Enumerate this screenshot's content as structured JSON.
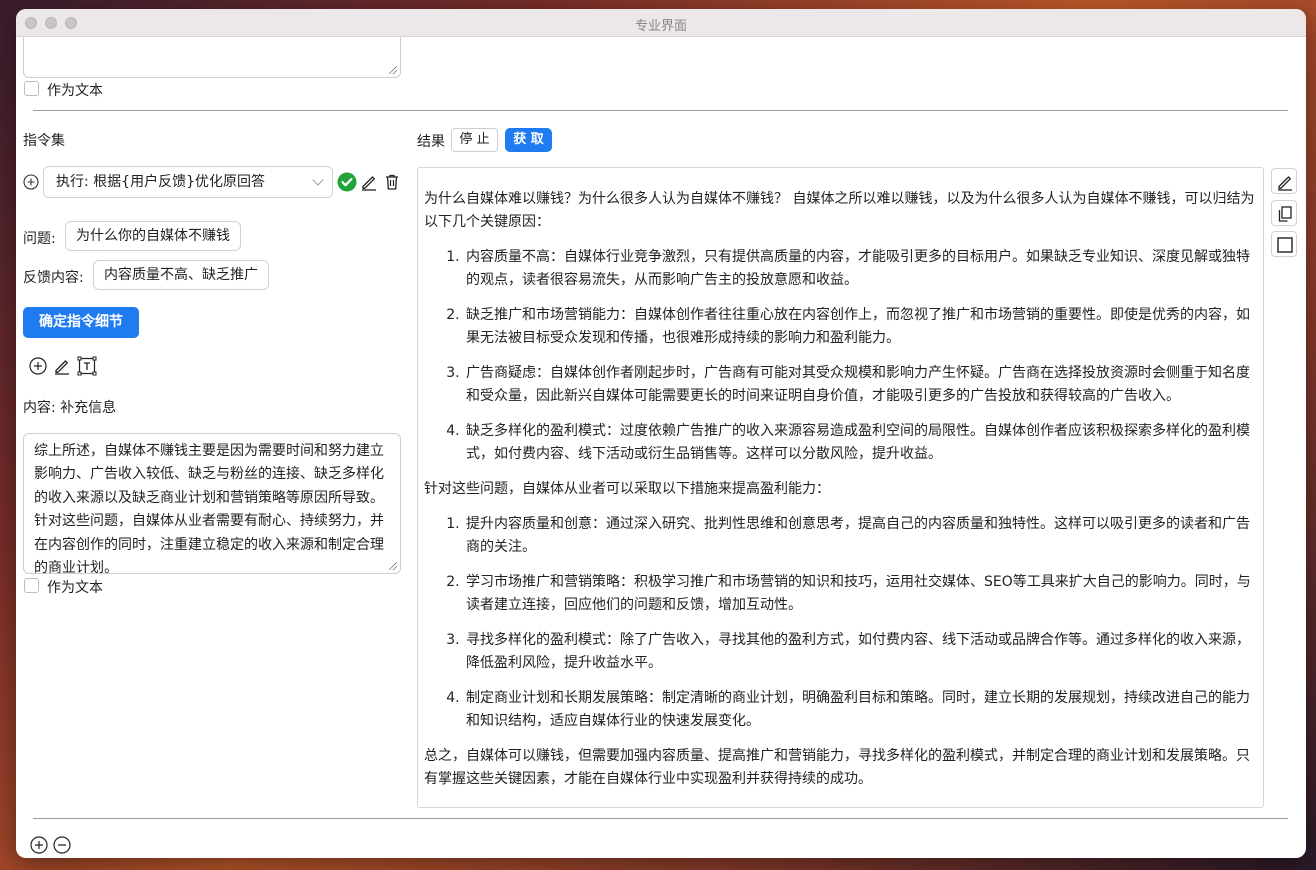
{
  "window": {
    "title": "专业界面"
  },
  "top_section": {
    "as_text_label": "作为文本"
  },
  "instruction_set": {
    "heading": "指令集",
    "command_select": "执行: 根据{用户反馈}优化原回答",
    "question_label": "问题:",
    "question_value": "为什么你的自媒体不赚钱",
    "feedback_label": "反馈内容:",
    "feedback_value": "内容质量不高、缺乏推广",
    "confirm_button": "确定指令细节",
    "content_label": "内容: 补充信息",
    "content_text": "综上所述，自媒体不赚钱主要是因为需要时间和努力建立影响力、广告收入较低、缺乏与粉丝的连接、缺乏多样化的收入来源以及缺乏商业计划和营销策略等原因所导致。针对这些问题，自媒体从业者需要有耐心、持续努力，并在内容创作的同时，注重建立稳定的收入来源和制定合理的商业计划。",
    "as_text_label": "作为文本"
  },
  "result": {
    "label": "结果",
    "stop_button": "停 止",
    "fetch_button": "获 取",
    "intro": "为什么自媒体难以赚钱？为什么很多人认为自媒体不赚钱？ 自媒体之所以难以赚钱，以及为什么很多人认为自媒体不赚钱，可以归结为以下几个关键原因：",
    "reasons": [
      "内容质量不高：自媒体行业竞争激烈，只有提供高质量的内容，才能吸引更多的目标用户。如果缺乏专业知识、深度见解或独特的观点，读者很容易流失，从而影响广告主的投放意愿和收益。",
      "缺乏推广和市场营销能力：自媒体创作者往往重心放在内容创作上，而忽视了推广和市场营销的重要性。即使是优秀的内容，如果无法被目标受众发现和传播，也很难形成持续的影响力和盈利能力。",
      "广告商疑虑：自媒体创作者刚起步时，广告商有可能对其受众规模和影响力产生怀疑。广告商在选择投放资源时会侧重于知名度和受众量，因此新兴自媒体可能需要更长的时间来证明自身价值，才能吸引更多的广告投放和获得较高的广告收入。",
      "缺乏多样化的盈利模式：过度依赖广告推广的收入来源容易造成盈利空间的局限性。自媒体创作者应该积极探索多样化的盈利模式，如付费内容、线下活动或衍生品销售等。这样可以分散风险，提升收益。"
    ],
    "measures_intro": "针对这些问题，自媒体从业者可以采取以下措施来提高盈利能力：",
    "measures": [
      "提升内容质量和创意：通过深入研究、批判性思维和创意思考，提高自己的内容质量和独特性。这样可以吸引更多的读者和广告商的关注。",
      "学习市场推广和营销策略：积极学习推广和市场营销的知识和技巧，运用社交媒体、SEO等工具来扩大自己的影响力。同时，与读者建立连接，回应他们的问题和反馈，增加互动性。",
      "寻找多样化的盈利模式：除了广告收入，寻找其他的盈利方式，如付费内容、线下活动或品牌合作等。通过多样化的收入来源，降低盈利风险，提升收益水平。",
      "制定商业计划和长期发展策略：制定清晰的商业计划，明确盈利目标和策略。同时，建立长期的发展规划，持续改进自己的能力和知识结构，适应自媒体行业的快速发展变化。"
    ],
    "conclusion": "总之，自媒体可以赚钱，但需要加强内容质量、提高推广和营销能力，寻找多样化的盈利模式，并制定合理的商业计划和发展策略。只有掌握这些关键因素，才能在自媒体行业中实现盈利并获得持续的成功。"
  },
  "colors": {
    "primary": "#1f7cf0",
    "success": "#22a33a"
  },
  "icons": {
    "add": "plus-circle-icon",
    "confirm": "check-circle-icon",
    "edit": "pencil-icon",
    "delete": "trash-icon",
    "text": "text-box-icon",
    "copy": "copy-icon",
    "square": "square-icon",
    "remove": "minus-circle-icon"
  }
}
